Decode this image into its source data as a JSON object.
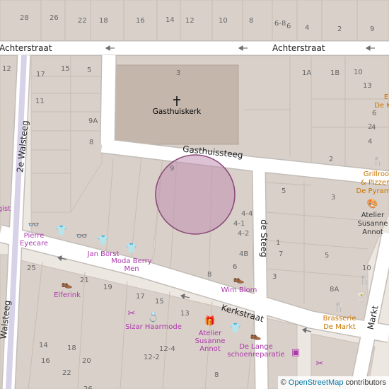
{
  "streets": {
    "achterstraat_w": "Achterstraat",
    "achterstraat_e": "Achterstraat",
    "gasthuissteeg": "Gasthuissteeg",
    "walsteeg_top": "2e Walsteeg",
    "walsteeg_bottom": "Walsteeg",
    "de_steeg": "de Steeg",
    "kerkstraat": "Kerkstraat",
    "markt": "Markt"
  },
  "house_numbers": [
    "28",
    "26",
    "22",
    "18",
    "16",
    "14",
    "12",
    "10",
    "8",
    "6-8",
    "6",
    "4",
    "2",
    "9",
    "12",
    "17",
    "15",
    "5",
    "3",
    "1A",
    "1B",
    "10",
    "13",
    "11",
    "9A",
    "8",
    "6",
    "4",
    "2",
    "4",
    "9",
    "5",
    "3",
    "2",
    "4-4",
    "4-1",
    "4-2",
    "1",
    "7",
    "3",
    "4B",
    "6",
    "8",
    "5",
    "10",
    "8A",
    "25",
    "21",
    "19",
    "17",
    "15",
    "13",
    "12-4",
    "12-2",
    "14",
    "16",
    "18",
    "20",
    "22",
    "26",
    "8"
  ],
  "pois": {
    "gasthuiskerk": "Gasthuiskerk",
    "pierre_eyecare_1": "Pierre",
    "pierre_eyecare_2": "Eyecare",
    "jan_borst": "Jan Borst",
    "moda_berry_1": "Moda Berry",
    "moda_berry_2": "Men",
    "wim_blom": "Wim Blom",
    "elferink": "Elferink",
    "sizar": "Sizar Haarmode",
    "atelier_s_1": "Atelier",
    "atelier_s_2": "Susanne",
    "atelier_s_3": "Annot",
    "de_lange_1": "De Lange",
    "de_lange_2": "schoenreparatie",
    "atelier_n_1": "Atelier",
    "atelier_n_2": "Susanne",
    "atelier_n_3": "Annot",
    "grillroom_1": "Grillroo",
    "grillroom_2": "& Pizzer",
    "grillroom_3": "De Pyram",
    "brasserie_1": "Brasserie",
    "brasserie_2": "De Markt",
    "edge_e_1": "E",
    "edge_e_2": "De K",
    "edge_gist": "gist"
  },
  "attribution": {
    "symbol": "©",
    "link": "OpenStreetMap",
    "suffix": "contributors"
  },
  "colors": {
    "background": "#ede7e2",
    "building": "#d9d0c9",
    "road": "#ffffff",
    "road_casing": "#c2bdb8",
    "church": "#c4b6ab",
    "shop": "#ac39ac",
    "food": "#c77400",
    "highlight_fill": "#c08fb0",
    "highlight_stroke": "#8a4b7a"
  }
}
